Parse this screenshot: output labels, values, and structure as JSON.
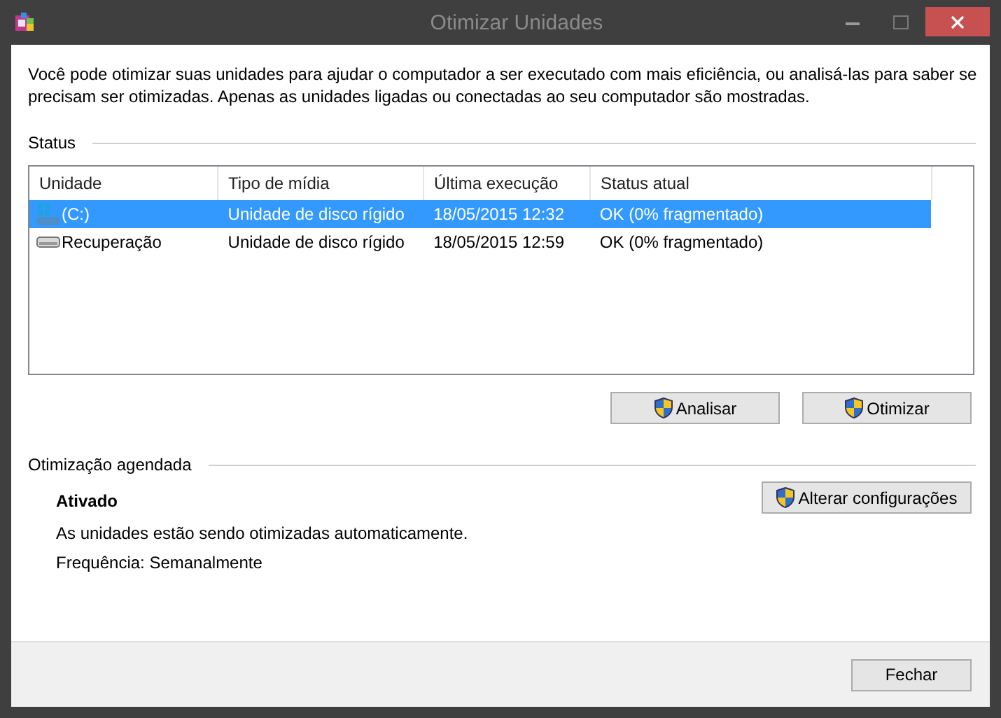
{
  "window": {
    "title": "Otimizar Unidades"
  },
  "intro": "Você pode otimizar suas unidades para ajudar o computador a ser executado com mais eficiência, ou analisá-las para saber se precisam ser otimizadas. Apenas as unidades ligadas ou conectadas ao seu computador são mostradas.",
  "status": {
    "heading": "Status",
    "table": {
      "columns": [
        "Unidade",
        "Tipo de mídia",
        "Última execução",
        "Status atual"
      ],
      "rows": [
        {
          "kind": "system",
          "selected": true,
          "cells": [
            "(C:)",
            "Unidade de disco rígido",
            "18/05/2015 12:32",
            "OK (0% fragmentado)"
          ]
        },
        {
          "kind": "drive",
          "selected": false,
          "cells": [
            "Recuperação",
            "Unidade de disco rígido",
            "18/05/2015 12:59",
            "OK (0% fragmentado)"
          ]
        }
      ]
    },
    "buttons": [
      "Analisar",
      "Otimizar"
    ]
  },
  "schedule": {
    "heading": "Otimização agendada",
    "state": "Ativado",
    "description": "As unidades estão sendo otimizadas automaticamente.",
    "frequency": "Frequência: Semanalmente",
    "button": "Alterar configurações"
  },
  "footer": {
    "button": "Fechar"
  }
}
